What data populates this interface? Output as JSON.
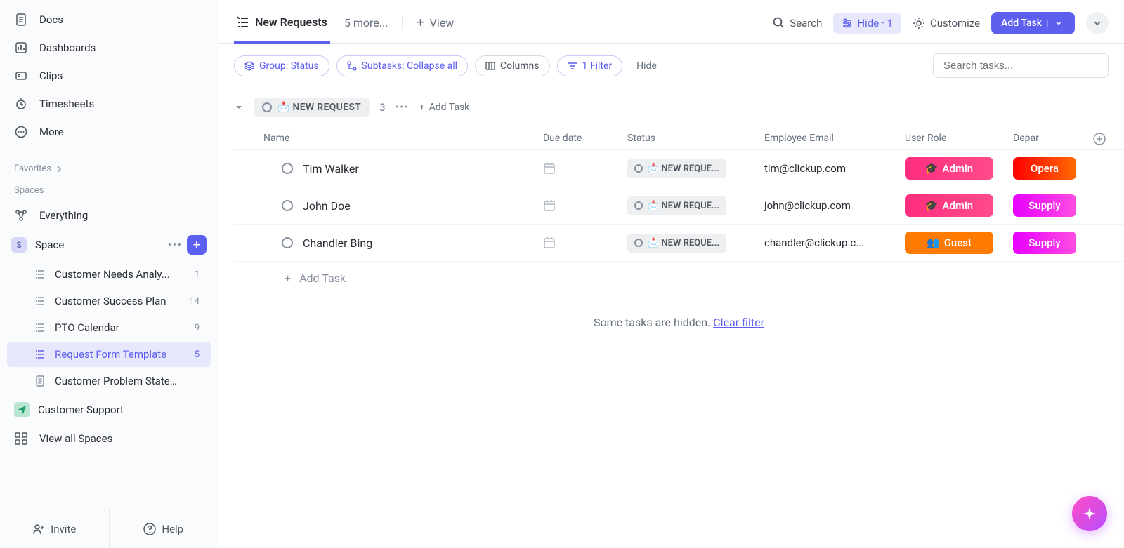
{
  "sidebar": {
    "nav": [
      {
        "label": "Docs",
        "icon": "doc"
      },
      {
        "label": "Dashboards",
        "icon": "dashboard"
      },
      {
        "label": "Clips",
        "icon": "clip"
      },
      {
        "label": "Timesheets",
        "icon": "timesheet"
      },
      {
        "label": "More",
        "icon": "more"
      }
    ],
    "favorites_label": "Favorites",
    "spaces_label": "Spaces",
    "everything_label": "Everything",
    "space_name": "Space",
    "space_letter": "S",
    "lists": [
      {
        "label": "Customer Needs Analy...",
        "count": "1",
        "active": false,
        "icon": "list"
      },
      {
        "label": "Customer Success Plan",
        "count": "14",
        "active": false,
        "icon": "list"
      },
      {
        "label": "PTO Calendar",
        "count": "9",
        "active": false,
        "icon": "list"
      },
      {
        "label": "Request Form Template",
        "count": "5",
        "active": true,
        "icon": "list"
      },
      {
        "label": "Customer Problem Statem...",
        "count": "",
        "active": false,
        "icon": "doc"
      }
    ],
    "customer_support_label": "Customer Support",
    "view_all_spaces_label": "View all Spaces",
    "invite_label": "Invite",
    "help_label": "Help"
  },
  "topbar": {
    "active_tab": "New Requests",
    "more_tabs": "5 more...",
    "view_label": "View",
    "search_label": "Search",
    "hide_label": "Hide",
    "hide_count": "1",
    "customize_label": "Customize",
    "add_task_label": "Add Task"
  },
  "filters": {
    "group_label": "Group: Status",
    "subtasks_label": "Subtasks: Collapse all",
    "columns_label": "Columns",
    "filter_label": "1 Filter",
    "hide_label": "Hide",
    "search_placeholder": "Search tasks..."
  },
  "group": {
    "status_label": "📩 NEW REQUEST",
    "count": "3",
    "add_task_label": "Add Task"
  },
  "columns": {
    "name": "Name",
    "due": "Due date",
    "status": "Status",
    "email": "Employee Email",
    "role": "User Role",
    "dept": "Depar"
  },
  "rows": [
    {
      "name": "Tim Walker",
      "status": "📩 NEW REQUE...",
      "email": "tim@clickup.com",
      "role": "Admin",
      "role_icon": "🎓",
      "role_class": "role-admin",
      "dept": "Opera",
      "dept_class": "dept-oper"
    },
    {
      "name": "John Doe",
      "status": "📩 NEW REQUE...",
      "email": "john@clickup.com",
      "role": "Admin",
      "role_icon": "🎓",
      "role_class": "role-admin",
      "dept": "Supply",
      "dept_class": "dept-supply"
    },
    {
      "name": "Chandler Bing",
      "status": "📩 NEW REQUE...",
      "email": "chandler@clickup.c...",
      "role": "Guest",
      "role_icon": "👥",
      "role_class": "role-guest",
      "dept": "Supply",
      "dept_class": "dept-supply"
    }
  ],
  "add_row_label": "Add Task",
  "hidden_msg": "Some tasks are hidden.",
  "clear_filter_label": "Clear filter"
}
